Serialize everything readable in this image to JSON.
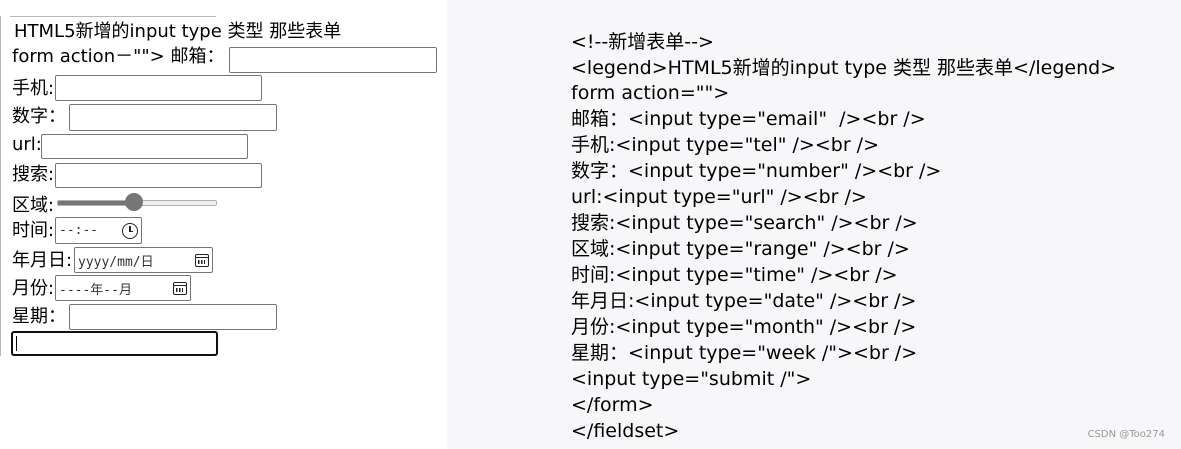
{
  "preview": {
    "legend": "HTML5新增的input type 类型 那些表单",
    "form_action_label": "form action－\"\"> 邮箱：",
    "labels": {
      "phone": "手机:",
      "number": "数字：",
      "url": "url:",
      "search": "搜索:",
      "range": "区域:",
      "time": "时间:",
      "date": "年月日:",
      "month": "月份:",
      "week": "星期："
    },
    "time_placeholder": "--:--",
    "date_placeholder": "yyyy/mm/日",
    "month_placeholder": "----年--月",
    "range_value_fraction": 0.48
  },
  "code_lines": [
    "<!--新增表单-->",
    "<legend>HTML5新增的input type 类型 那些表单</legend>",
    "form action=\"\">",
    "邮箱：<input type=\"email\"  /><br />",
    "手机:<input type=\"tel\" /><br />",
    "数字：<input type=\"number\" /><br />",
    "url:<input type=\"url\" /><br />",
    "搜索:<input type=\"search\" /><br />",
    "区域:<input type=\"range\" /><br />",
    "时间:<input type=\"time\" /><br />",
    "年月日:<input type=\"date\" /><br />",
    "月份:<input type=\"month\" /><br />",
    "星期：<input type=\"week /\"><br />",
    "<input type=\"submit /\">",
    "</form>",
    "</fieldset>"
  ],
  "watermark": "CSDN @Too274"
}
